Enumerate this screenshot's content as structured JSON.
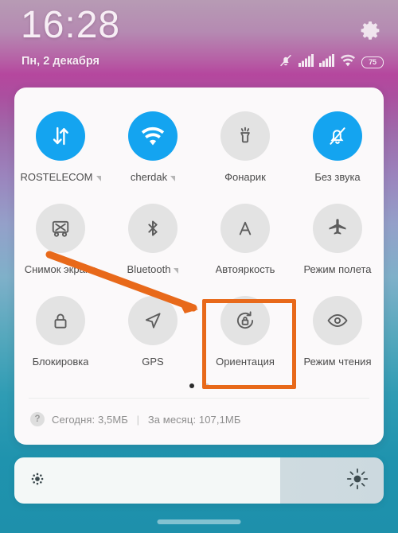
{
  "statusbar": {
    "time": "16:28",
    "date": "Пн, 2 декабря",
    "settings_icon": "gear-icon",
    "icons": [
      {
        "name": "bell-muted-icon"
      },
      {
        "name": "signal-bars-sim1-icon"
      },
      {
        "name": "signal-bars-sim2-icon"
      },
      {
        "name": "wifi-icon"
      }
    ],
    "battery_percent": "75"
  },
  "panel": {
    "rows": [
      {
        "tiles": [
          {
            "label": "ROSTELECOM",
            "icon": "mobile-data-icon",
            "state": "on",
            "expandable": true
          },
          {
            "label": "cherdak",
            "icon": "wifi-icon",
            "state": "on",
            "expandable": true
          },
          {
            "label": "Фонарик",
            "icon": "flashlight-icon",
            "state": "off",
            "expandable": false
          },
          {
            "label": "Без звука",
            "icon": "bell-muted-icon",
            "state": "on",
            "expandable": false
          }
        ]
      },
      {
        "tiles": [
          {
            "label": "Снимок экрана",
            "icon": "screenshot-icon",
            "state": "off",
            "expandable": false
          },
          {
            "label": "Bluetooth",
            "icon": "bluetooth-icon",
            "state": "off",
            "expandable": true
          },
          {
            "label": "Автояркость",
            "icon": "auto-brightness-icon",
            "state": "off",
            "expandable": false
          },
          {
            "label": "Режим полета",
            "icon": "airplane-icon",
            "state": "off",
            "expandable": false
          }
        ]
      },
      {
        "tiles": [
          {
            "label": "Блокировка",
            "icon": "lock-icon",
            "state": "off",
            "expandable": false
          },
          {
            "label": "GPS",
            "icon": "location-arrow-icon",
            "state": "off",
            "expandable": false
          },
          {
            "label": "Ориентация",
            "icon": "screen-rotation-lock-icon",
            "state": "off",
            "expandable": false
          },
          {
            "label": "Режим чтения",
            "icon": "eye-icon",
            "state": "off",
            "expandable": false
          }
        ]
      }
    ],
    "pager": {
      "pages": 2,
      "active": 1
    },
    "data_usage": {
      "help_icon_label": "?",
      "today": "Сегодня: 3,5МБ",
      "separator": "|",
      "month": "За месяц: 107,1МБ"
    }
  },
  "brightness": {
    "low_icon": "brightness-low-icon",
    "high_icon": "brightness-high-icon",
    "level_percent": 72
  },
  "annotation": {
    "highlight_target": "Ориентация",
    "arrow_color": "#e8691a",
    "box_color": "#e8691a"
  },
  "colors": {
    "tile_active": "#14a4f0",
    "tile_inactive": "#e3e3e3",
    "panel_bg": "#fbf9fa",
    "accent_orange": "#e8691a"
  }
}
